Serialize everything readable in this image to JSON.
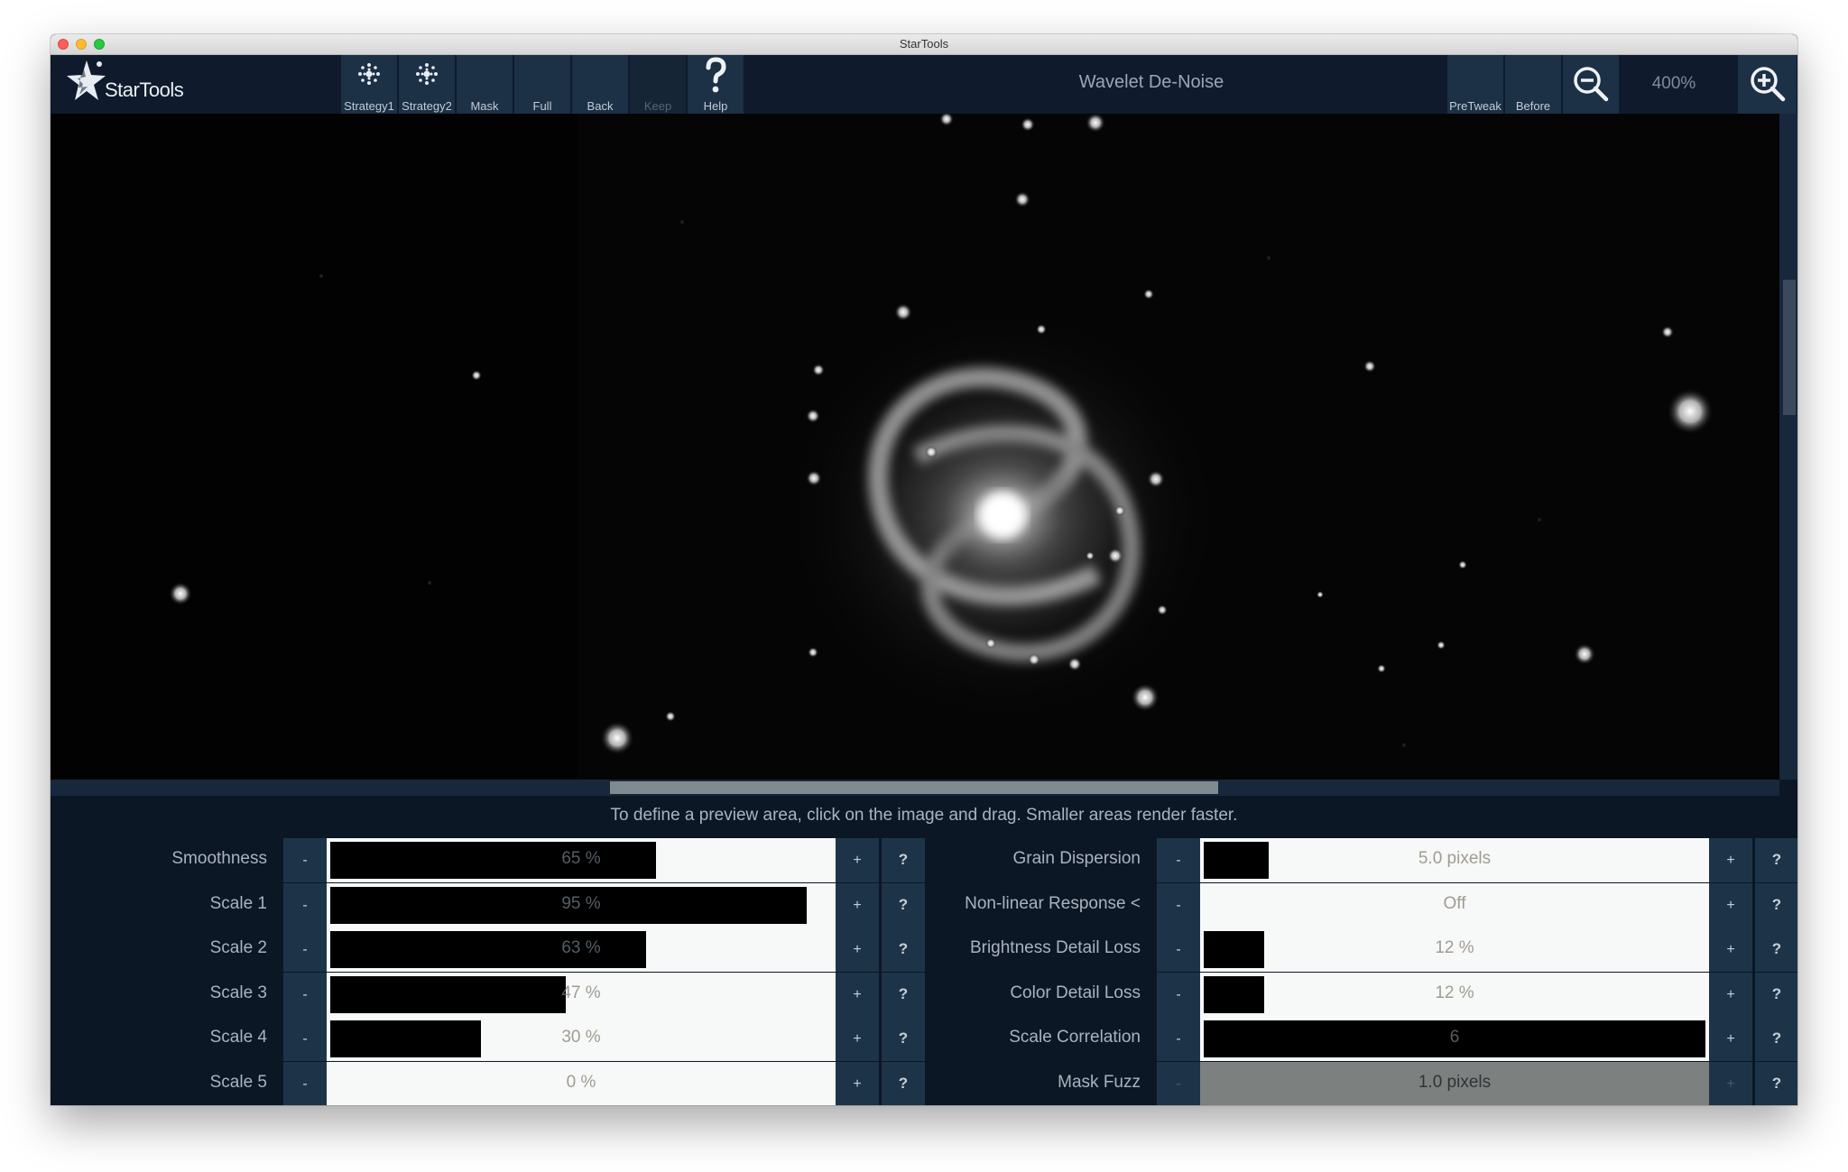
{
  "window": {
    "title": "StarTools"
  },
  "app": {
    "name": "StarTools"
  },
  "toolbar": {
    "buttons": [
      {
        "label": "Strategy1",
        "icon": "strategy-dots-icon",
        "enabled": true
      },
      {
        "label": "Strategy2",
        "icon": "strategy-dots-icon",
        "enabled": true
      },
      {
        "label": "Mask",
        "enabled": true
      },
      {
        "label": "Full",
        "enabled": true
      },
      {
        "label": "Back",
        "enabled": true
      },
      {
        "label": "Keep",
        "enabled": false
      },
      {
        "label": "Help",
        "icon": "help-icon",
        "enabled": true
      }
    ],
    "module_title": "Wavelet De-Noise",
    "right_buttons": [
      {
        "label": "PreTweak"
      },
      {
        "label": "Before"
      }
    ],
    "zoom_out_icon": "zoom-out-icon",
    "zoom_level": "400%",
    "zoom_in_icon": "zoom-in-icon"
  },
  "hint": "To define a preview area, click on the image and drag. Smaller areas render faster.",
  "params_left": [
    {
      "label": "Smoothness",
      "value": "65 %",
      "fraction": 0.65
    },
    {
      "label": "Scale 1",
      "value": "95 %",
      "fraction": 0.95
    },
    {
      "label": "Scale 2",
      "value": "63 %",
      "fraction": 0.63
    },
    {
      "label": "Scale 3",
      "value": "47 %",
      "fraction": 0.47
    },
    {
      "label": "Scale 4",
      "value": "30 %",
      "fraction": 0.3
    },
    {
      "label": "Scale 5",
      "value": "0 %",
      "fraction": 0.0
    }
  ],
  "params_right": [
    {
      "label": "Grain Dispersion",
      "value": "5.0 pixels",
      "fraction": 0.13
    },
    {
      "label": "Non-linear Response <",
      "value": "Off",
      "fraction": 0.0
    },
    {
      "label": "Brightness Detail Loss",
      "value": "12 %",
      "fraction": 0.12
    },
    {
      "label": "Color Detail Loss",
      "value": "12 %",
      "fraction": 0.12
    },
    {
      "label": "Scale Correlation",
      "value": "6",
      "fraction": 1.0
    },
    {
      "label": "Mask Fuzz",
      "value": "1.0 pixels",
      "fraction": 0.0,
      "disabled": true
    }
  ],
  "buttons": {
    "minus": "-",
    "plus": "+",
    "help": "?"
  },
  "colors": {
    "background": "#0c1726",
    "button": "#1d3448",
    "slider_track": "#f6f9f7",
    "slider_fill": "#000000",
    "disabled_track": "#7c807f"
  }
}
